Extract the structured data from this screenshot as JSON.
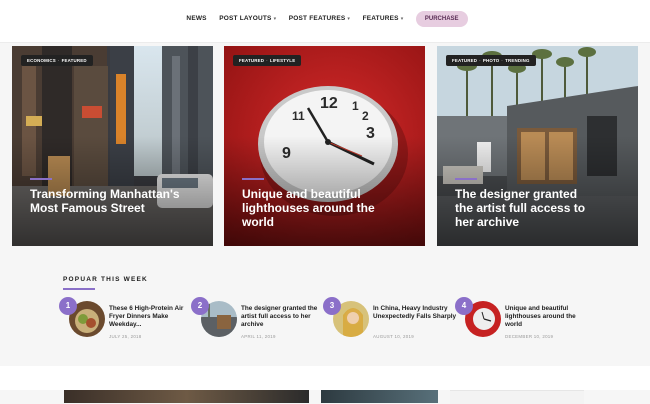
{
  "nav": {
    "items": [
      {
        "label": "NEWS",
        "caret": ""
      },
      {
        "label": "POST LAYOUTS",
        "caret": "▾"
      },
      {
        "label": "POST FEATURES",
        "caret": "▾"
      },
      {
        "label": "FEATURES",
        "caret": "▾"
      }
    ],
    "purchase": "PURCHASE"
  },
  "hero": [
    {
      "tags": [
        "ECONOMICS",
        "FEATURED"
      ],
      "title": "Transforming Manhattan's Most Famous Street"
    },
    {
      "tags": [
        "FEATURED",
        "LIFESTYLE"
      ],
      "title": "Unique and beautiful lighthouses around the world"
    },
    {
      "tags": [
        "FEATURED",
        "PHOTO",
        "TRENDING"
      ],
      "title": "The designer granted the artist full access to her archive"
    }
  ],
  "popular": {
    "heading": "POPUAR THIS WEEK",
    "items": [
      {
        "num": "1",
        "title": "These 6 High-Protein Air Fryer Dinners Make Weekday...",
        "date": "JULY 25, 2018"
      },
      {
        "num": "2",
        "title": "The designer granted the artist full access to her archive",
        "date": "APRIL 11, 2019"
      },
      {
        "num": "3",
        "title": "In China, Heavy Industry Unexpectedly Falls Sharply",
        "date": "AUGUST 10, 2019"
      },
      {
        "num": "4",
        "title": "Unique and beautiful lighthouses around the world",
        "date": "DECEMBER 10, 2019"
      }
    ]
  }
}
